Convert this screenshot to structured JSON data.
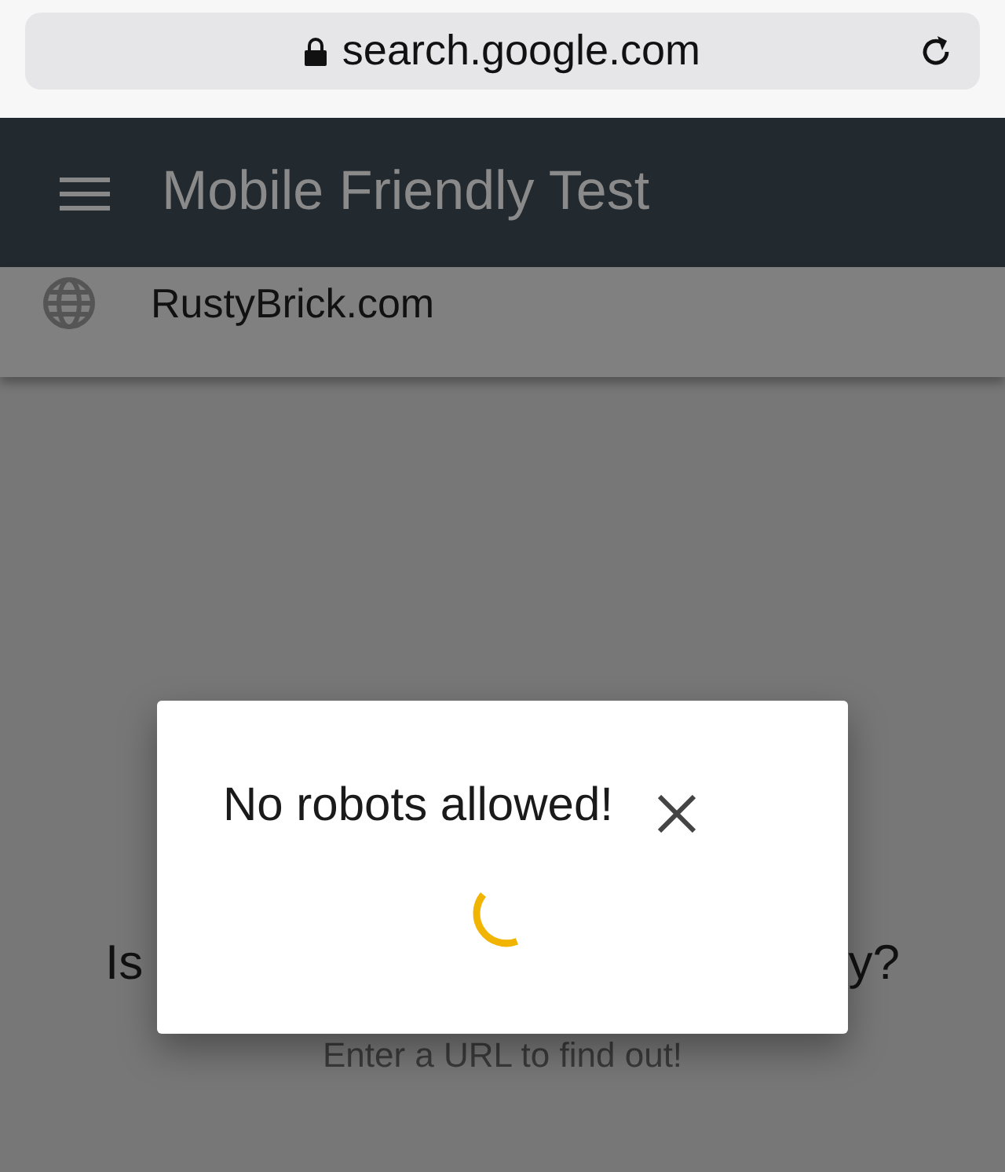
{
  "browser": {
    "address": "search.google.com"
  },
  "app_bar": {
    "title": "Mobile Friendly Test"
  },
  "url_row": {
    "value": "RustyBrick.com"
  },
  "page": {
    "heading_left": "Is",
    "heading_right": "y?",
    "subtitle": "Enter a URL to find out!"
  },
  "dialog": {
    "title": "No robots allowed!"
  }
}
